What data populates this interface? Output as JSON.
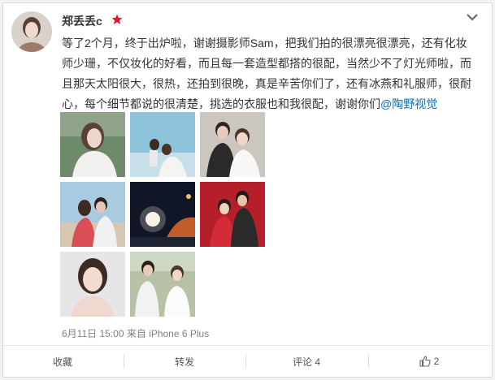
{
  "post": {
    "username": "郑丢丢c",
    "text_before": "等了2个月，终于出炉啦，谢谢摄影师Sam，把我们拍的很漂亮很漂亮，还有化妆师少珊，不仅妆化的好看，而且每一套造型都搭的很配，当然少不了灯光师啦，而且那天太阳很大，很热，还拍到很晚，真是辛苦你们了，还有冰燕和礼服师，很耐心，每个细节都说的很清楚，挑选的衣服也和我很配，谢谢你们",
    "mention": "@陶野视觉",
    "meta": "6月11日 15:00 来自 iPhone 6 Plus"
  },
  "actions": {
    "favorite": "收藏",
    "repost": "转发",
    "comment": "评论 4",
    "like_count": "2"
  },
  "colors": {
    "link": "#0c6eb6",
    "vip_badge": "#e6162d"
  },
  "icons": {
    "vip": "red-star-icon",
    "menu": "chevron-down-icon",
    "like": "thumbs-up-icon"
  }
}
